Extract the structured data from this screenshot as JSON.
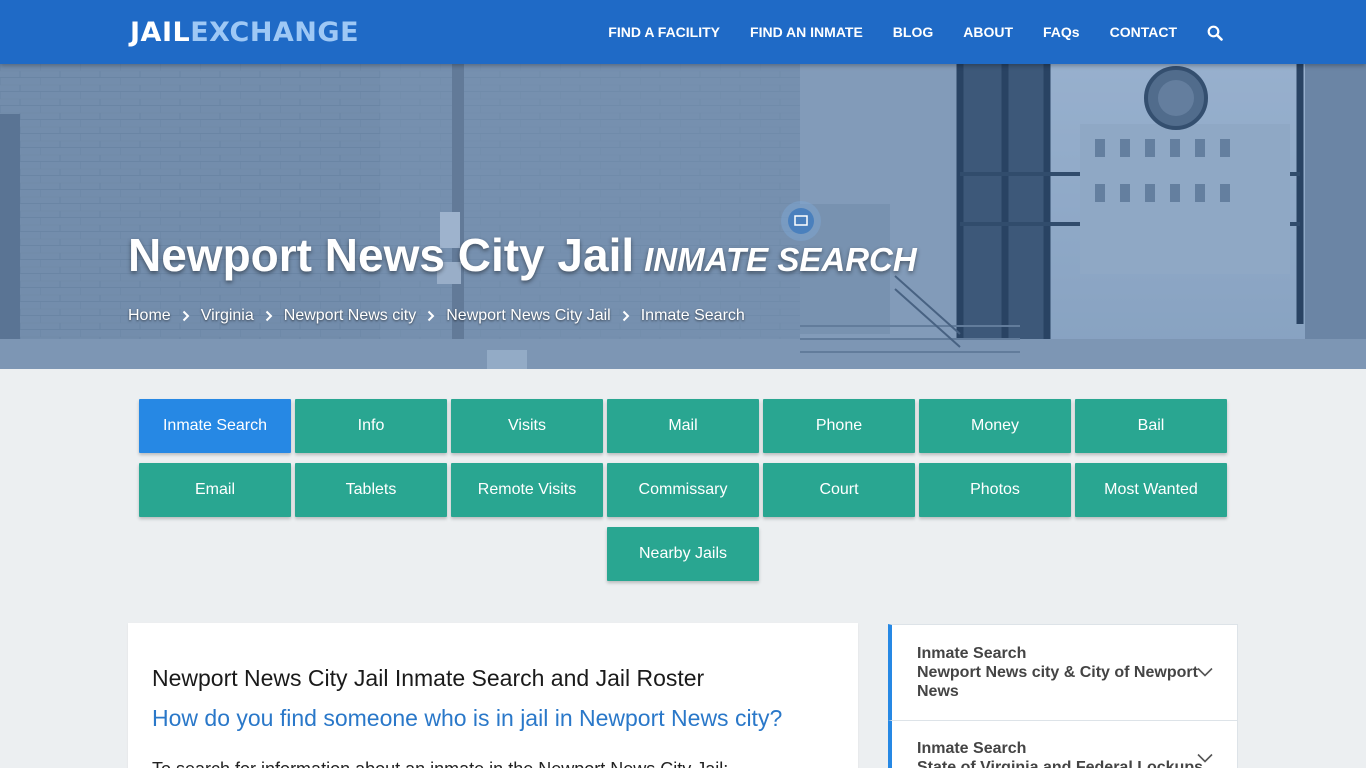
{
  "logo": {
    "part1": "JAIL",
    "part2": "EXCHANGE"
  },
  "nav": {
    "items": [
      "FIND A FACILITY",
      "FIND AN INMATE",
      "BLOG",
      "ABOUT",
      "FAQs",
      "CONTACT"
    ],
    "search_icon": "search-icon"
  },
  "hero": {
    "title": "Newport News City Jail",
    "subtitle": "INMATE SEARCH",
    "breadcrumb": [
      "Home",
      "Virginia",
      "Newport News city",
      "Newport News City Jail",
      "Inmate Search"
    ]
  },
  "buttons": {
    "row1": [
      "Inmate Search",
      "Info",
      "Visits",
      "Mail",
      "Phone",
      "Money",
      "Bail"
    ],
    "row2": [
      "Email",
      "Tablets",
      "Remote Visits",
      "Commissary",
      "Court",
      "Photos",
      "Most Wanted"
    ],
    "row3": [
      "Nearby Jails"
    ],
    "active": "Inmate Search"
  },
  "content": {
    "heading": "Newport News City Jail Inmate Search and Jail Roster",
    "subheading": "How do you find someone who is in jail in Newport News city?",
    "paragraph": "To search for information about an inmate in the Newport News City Jail:"
  },
  "sidebar": {
    "items": [
      {
        "label": "Inmate Search",
        "detail": [
          "Newport News city & City of Newport",
          "News"
        ]
      },
      {
        "label": "Inmate Search",
        "detail": [
          "State of Virginia and Federal Lockups"
        ]
      }
    ]
  },
  "colors": {
    "nav_bg": "#1f6ac6",
    "button_bg": "#29a691",
    "button_active": "#2688e4",
    "link_blue": "#2a78c9"
  }
}
